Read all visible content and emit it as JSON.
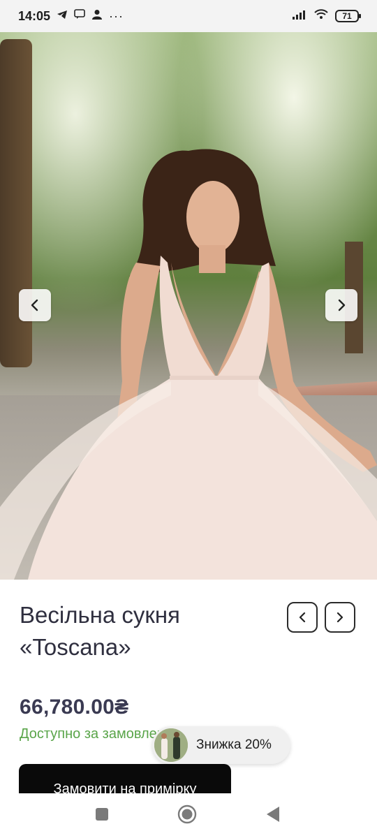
{
  "status_bar": {
    "time": "14:05",
    "battery": "71",
    "left_icons": [
      "telegram-icon",
      "chat-icon",
      "user-icon",
      "more-dots-icon"
    ],
    "right_icons": [
      "signal-icon",
      "wifi-icon",
      "battery-icon"
    ]
  },
  "gallery": {
    "prev_icon": "chevron-left-icon",
    "next_icon": "chevron-right-icon"
  },
  "product": {
    "title_line1": "Весільна сукня",
    "title_line2": "«Toscana»",
    "price": "66,780.00₴",
    "availability": "Доступно за замовленням",
    "order_button": "Замовити на примірку"
  },
  "promo": {
    "discount_label": "Знижка 20%"
  },
  "system_nav": {
    "icons": [
      "recent-apps-icon",
      "home-icon",
      "back-icon"
    ]
  },
  "colors": {
    "accent_green": "#5aa54a",
    "button_black": "#0a0a0a",
    "title_text": "#2f2f3f"
  }
}
